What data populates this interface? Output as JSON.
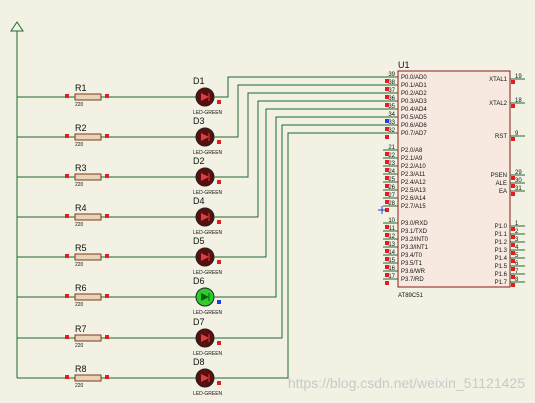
{
  "chip": {
    "name": "U1",
    "part": "AT89C51",
    "left_pins_p0": [
      {
        "num": "39",
        "name": "P0.0/AD0"
      },
      {
        "num": "38",
        "name": "P0.1/AD1"
      },
      {
        "num": "37",
        "name": "P0.2/AD2"
      },
      {
        "num": "36",
        "name": "P0.3/AD3"
      },
      {
        "num": "35",
        "name": "P0.4/AD4"
      },
      {
        "num": "34",
        "name": "P0.5/AD5"
      },
      {
        "num": "33",
        "name": "P0.6/AD6"
      },
      {
        "num": "32",
        "name": "P0.7/AD7"
      }
    ],
    "left_pins_p2": [
      {
        "num": "21",
        "name": "P2.0/A8"
      },
      {
        "num": "22",
        "name": "P2.1/A9"
      },
      {
        "num": "23",
        "name": "P2.2/A10"
      },
      {
        "num": "24",
        "name": "P2.3/A11"
      },
      {
        "num": "25",
        "name": "P2.4/A12"
      },
      {
        "num": "26",
        "name": "P2.5/A13"
      },
      {
        "num": "27",
        "name": "P2.6/A14"
      },
      {
        "num": "28",
        "name": "P2.7/A15"
      }
    ],
    "left_pins_p3": [
      {
        "num": "10",
        "name": "P3.0/RXD"
      },
      {
        "num": "11",
        "name": "P3.1/TXD"
      },
      {
        "num": "12",
        "name": "P3.2/INT0"
      },
      {
        "num": "13",
        "name": "P3.3/INT1"
      },
      {
        "num": "14",
        "name": "P3.4/T0"
      },
      {
        "num": "15",
        "name": "P3.5/T1"
      },
      {
        "num": "16",
        "name": "P3.6/WR"
      },
      {
        "num": "17",
        "name": "P3.7/RD"
      }
    ],
    "right_pins_top": [
      {
        "num": "19",
        "name": "XTAL1"
      },
      {
        "num": "18",
        "name": "XTAL2"
      },
      {
        "num": "9",
        "name": "RST"
      }
    ],
    "right_pins_ctrl": [
      {
        "num": "29",
        "name": "PSEN"
      },
      {
        "num": "30",
        "name": "ALE"
      },
      {
        "num": "31",
        "name": "EA"
      }
    ],
    "right_pins_p1": [
      {
        "num": "1",
        "name": "P1.0"
      },
      {
        "num": "2",
        "name": "P1.1"
      },
      {
        "num": "3",
        "name": "P1.2"
      },
      {
        "num": "4",
        "name": "P1.3"
      },
      {
        "num": "5",
        "name": "P1.4"
      },
      {
        "num": "6",
        "name": "P1.5"
      },
      {
        "num": "7",
        "name": "P1.6"
      },
      {
        "num": "8",
        "name": "P1.7"
      }
    ]
  },
  "resistors": [
    {
      "ref": "R1",
      "value": "220"
    },
    {
      "ref": "R2",
      "value": "220"
    },
    {
      "ref": "R3",
      "value": "220"
    },
    {
      "ref": "R4",
      "value": "220"
    },
    {
      "ref": "R5",
      "value": "220"
    },
    {
      "ref": "R6",
      "value": "220"
    },
    {
      "ref": "R7",
      "value": "220"
    },
    {
      "ref": "R8",
      "value": "220"
    }
  ],
  "leds": [
    {
      "ref": "D1",
      "type": "LED-GREEN",
      "state": "off"
    },
    {
      "ref": "D3",
      "type": "LED-GREEN",
      "state": "off"
    },
    {
      "ref": "D2",
      "type": "LED-GREEN",
      "state": "off"
    },
    {
      "ref": "D4",
      "type": "LED-GREEN",
      "state": "off"
    },
    {
      "ref": "D5",
      "type": "LED-GREEN",
      "state": "off"
    },
    {
      "ref": "D6",
      "type": "LED-GREEN",
      "state": "on"
    },
    {
      "ref": "D7",
      "type": "LED-GREEN",
      "state": "off"
    },
    {
      "ref": "D8",
      "type": "LED-GREEN",
      "state": "off"
    }
  ],
  "colors": {
    "background": "#f2f1e4",
    "wire": "#1f6b2e",
    "chip_fill": "#f7e9df",
    "chip_border": "#8b1a1a",
    "led_off": "#5a0f0f",
    "led_on": "#2ecc2e",
    "marker_red": "#e02020",
    "marker_blue": "#2040e0"
  },
  "watermark": "https://blog.csdn.net/weixin_51121425"
}
